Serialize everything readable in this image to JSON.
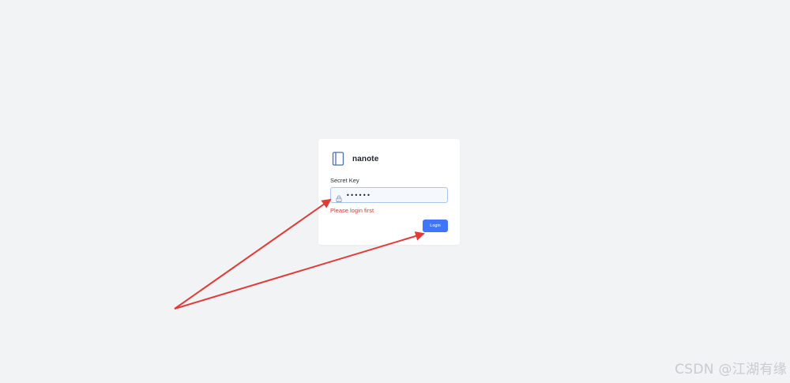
{
  "app": {
    "name": "nanote"
  },
  "login_form": {
    "field_label": "Secret Key",
    "secret_value": "••••••",
    "error_message": "Please login first",
    "login_button_label": "Login"
  },
  "icons": {
    "brand": "notebook-icon",
    "input": "lock-icon"
  },
  "colors": {
    "background": "#f2f3f5",
    "card": "#ffffff",
    "accent": "#3d76f6",
    "error": "#e5322d",
    "annotation_arrow": "#e53935"
  },
  "watermark": "CSDN @江湖有缘"
}
